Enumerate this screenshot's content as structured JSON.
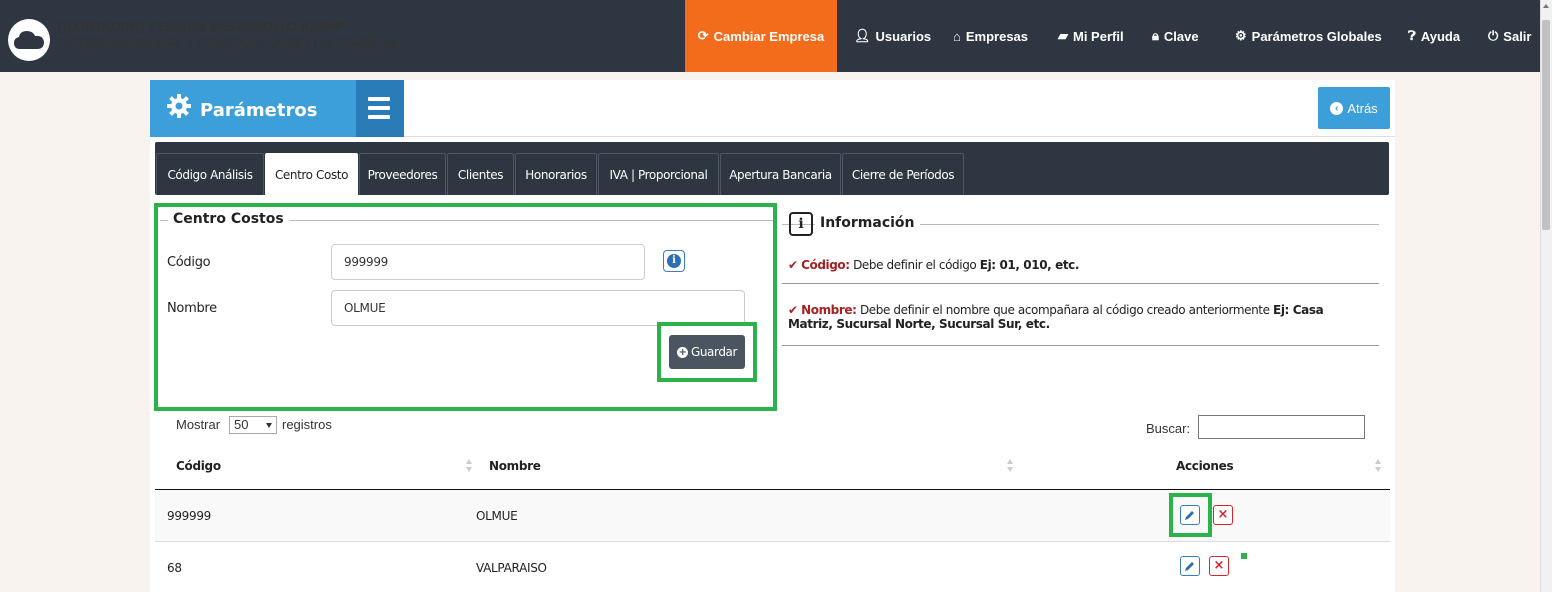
{
  "header": {
    "title": "[ICONTADOR] VERSION DESARROLLO IQAMP",
    "subtitle": "DISTRIBUIDORA AGR. Y COMERCIAL JOSE LUIS CORDOVA",
    "nav": {
      "cambiar_empresa": "Cambiar Empresa",
      "usuarios": "Usuarios",
      "empresas": "Empresas",
      "mi_perfil": "Mi Perfil",
      "clave": "Clave",
      "parametros_globales": "Parámetros Globales",
      "ayuda": "Ayuda",
      "salir": "Salir"
    },
    "accent_color": "#f26c1b"
  },
  "panel": {
    "title": "Parámetros",
    "back_label": "Atrás",
    "accent_color": "#3c9fd9"
  },
  "tabs": [
    {
      "label": "Código Análisis"
    },
    {
      "label": "Centro Costo"
    },
    {
      "label": "Proveedores"
    },
    {
      "label": "Clientes"
    },
    {
      "label": "Honorarios"
    },
    {
      "label": "IVA | Proporcional"
    },
    {
      "label": "Apertura Bancaria"
    },
    {
      "label": "Cierre de Períodos"
    }
  ],
  "form": {
    "legend": "Centro Costos",
    "codigo_label": "Código",
    "codigo_value": "999999",
    "nombre_label": "Nombre",
    "nombre_value": "OLMUE",
    "save_label": "Guardar"
  },
  "info": {
    "legend": "Información",
    "line1_key": "Código:",
    "line1_text": "Debe definir el código",
    "line1_example": "Ej: 01, 010, etc.",
    "line2_key": "Nombre:",
    "line2_text": "Debe definir el nombre que acompañara al código creado anteriormente",
    "line2_example_a": "Ej: Casa",
    "line2_example_b": "Matriz, Sucursal Norte, Sucursal Sur, etc."
  },
  "table": {
    "show_prefix": "Mostrar",
    "page_length": "50",
    "show_suffix": "registros",
    "search_label": "Buscar:",
    "search_value": "",
    "columns": [
      "Código",
      "Nombre",
      "Acciones"
    ],
    "rows": [
      {
        "codigo": "999999",
        "nombre": "OLMUE"
      },
      {
        "codigo": "68",
        "nombre": "VALPARAISO"
      }
    ]
  }
}
